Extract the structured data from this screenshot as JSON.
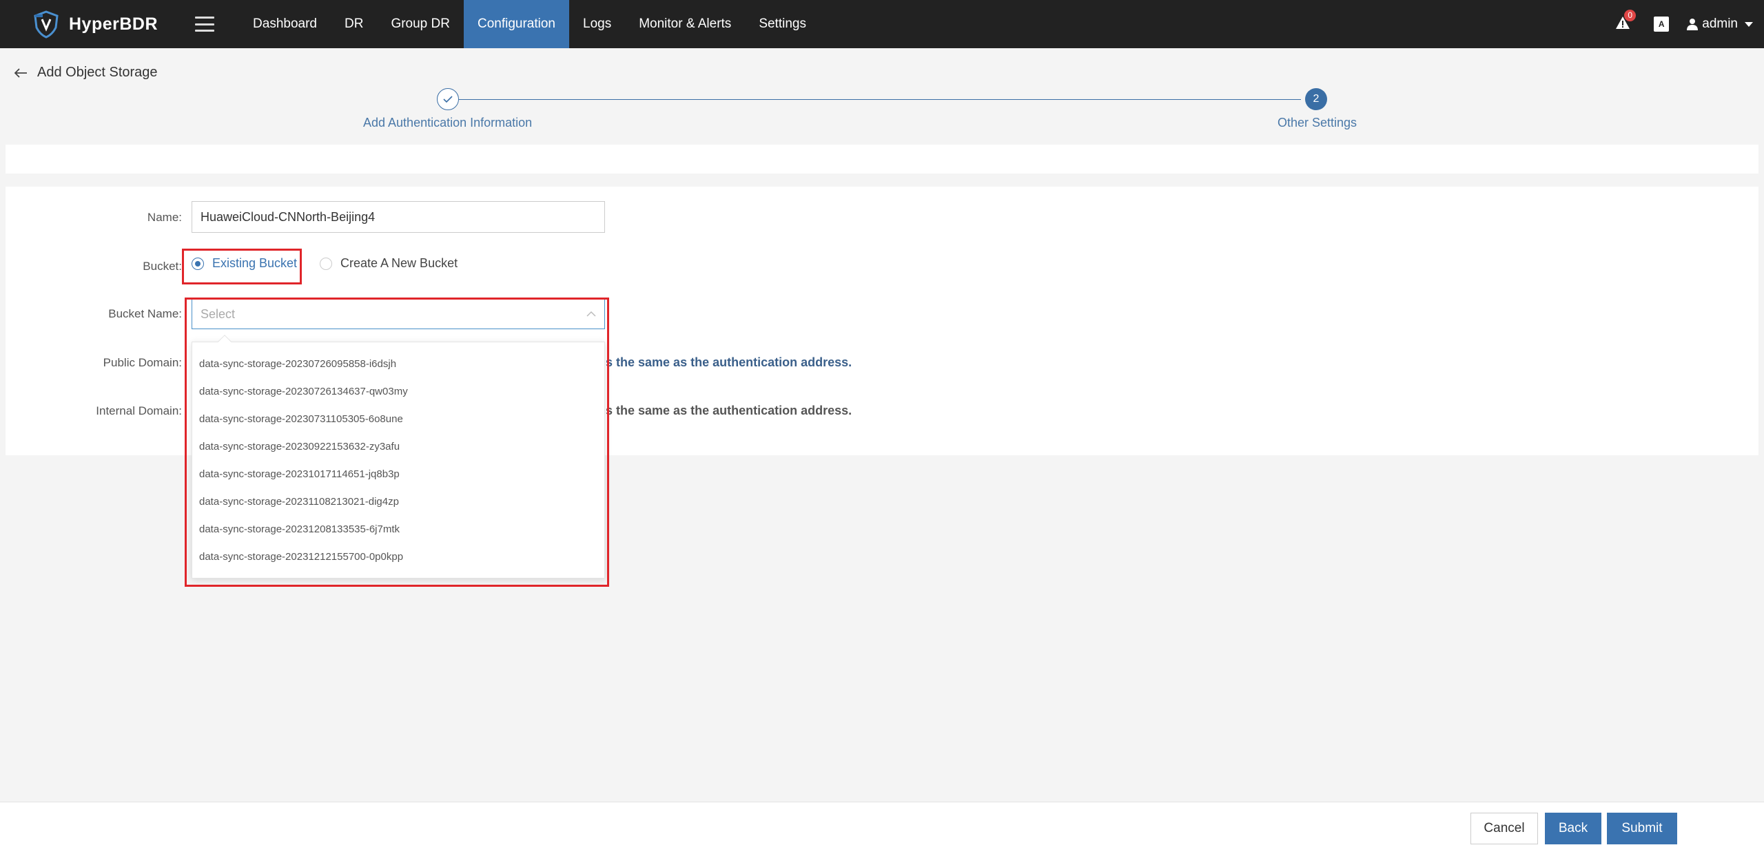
{
  "app": {
    "name": "HyperBDR"
  },
  "nav": {
    "items": [
      {
        "label": "Dashboard"
      },
      {
        "label": "DR"
      },
      {
        "label": "Group DR"
      },
      {
        "label": "Configuration",
        "active": true
      },
      {
        "label": "Logs"
      },
      {
        "label": "Monitor & Alerts"
      },
      {
        "label": "Settings"
      }
    ]
  },
  "topright": {
    "alert_count": "0",
    "lang_label": "A",
    "user": "admin"
  },
  "page": {
    "title": "Add Object Storage"
  },
  "steps": [
    {
      "label": "Add Authentication Information",
      "status": "done"
    },
    {
      "label": "Other Settings",
      "number": "2",
      "status": "current"
    }
  ],
  "form": {
    "name_label": "Name:",
    "name_value": "HuaweiCloud-CNNorth-Beijing4",
    "bucket_label": "Bucket:",
    "bucket_options": [
      "Existing Bucket",
      "Create A New Bucket"
    ],
    "bucket_selected": "Existing Bucket",
    "bucket_name_label": "Bucket Name:",
    "bucket_name_placeholder": "Select",
    "public_domain_label": "Public Domain:",
    "public_domain_note": "is the same as the authentication address.",
    "internal_domain_label": "Internal Domain:",
    "internal_domain_note": "is the same as the authentication address."
  },
  "dropdown": {
    "items": [
      "data-sync-storage-20230726095858-i6dsjh",
      "data-sync-storage-20230726134637-qw03my",
      "data-sync-storage-20230731105305-6o8une",
      "data-sync-storage-20230922153632-zy3afu",
      "data-sync-storage-20231017114651-jq8b3p",
      "data-sync-storage-20231108213021-dig4zp",
      "data-sync-storage-20231208133535-6j7mtk",
      "data-sync-storage-20231212155700-0p0kpp"
    ]
  },
  "footer": {
    "cancel": "Cancel",
    "back": "Back",
    "submit": "Submit"
  },
  "colors": {
    "accent": "#3a73b0",
    "topbar": "#222222",
    "highlight": "#e0252a"
  }
}
